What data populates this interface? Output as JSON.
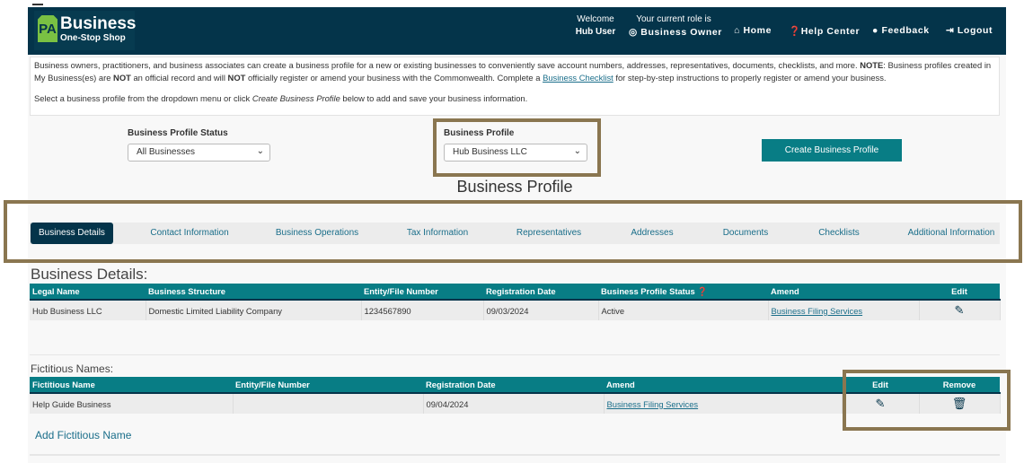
{
  "header": {
    "logo": {
      "mark": "PA",
      "title": "Business",
      "subtitle": "One-Stop Shop"
    },
    "welcome_label": "Welcome",
    "user_name": "Hub User",
    "role_label": "Your current role is",
    "role": "Business Owner",
    "role_icon": "user-circle-icon",
    "nav": [
      {
        "label": "Home",
        "icon": "home-icon"
      },
      {
        "label": "Help Center",
        "icon": "question-circle-icon"
      },
      {
        "label": "Feedback",
        "icon": "comment-icon"
      },
      {
        "label": "Logout",
        "icon": "sign-out-icon"
      }
    ]
  },
  "info": {
    "p1_a": "Business owners, practitioners, and business associates can create a business profile for a new or existing businesses to conveniently save account numbers, addresses, representatives, documents, checklists, and more. ",
    "p1_note": "NOTE",
    "p1_b": ": Business profiles created in My Business(es) are ",
    "not1": "NOT",
    "p1_c": " an official record and will ",
    "not2": "NOT",
    "p1_d": " officially register or amend your business with the Commonwealth. Complete a ",
    "link": "Business Checklist",
    "p1_e": " for step-by-step instructions to properly register or amend your business.",
    "p2_a": "Select a business profile from the dropdown menu or click ",
    "p2_em": "Create Business Profile",
    "p2_b": " below to add and save your business information."
  },
  "filters": {
    "status_label": "Business Profile Status",
    "status_value": "All Businesses",
    "profile_label": "Business Profile",
    "profile_value": "Hub Business LLC",
    "create_label": "Create Business Profile"
  },
  "page_title": "Business Profile",
  "tabs": [
    "Business Details",
    "Contact Information",
    "Business Operations",
    "Tax Information",
    "Representatives",
    "Addresses",
    "Documents",
    "Checklists",
    "Additional Information"
  ],
  "active_tab": "Business Details",
  "details": {
    "heading": "Business Details:",
    "columns": [
      "Legal Name",
      "Business Structure",
      "Entity/File Number",
      "Registration Date",
      "Business Profile Status",
      "Amend",
      "Edit"
    ],
    "row": {
      "legal_name": "Hub Business LLC",
      "structure": "Domestic Limited Liability Company",
      "entity": "1234567890",
      "reg_date": "09/03/2024",
      "status": "Active",
      "amend": "Business Filing Services"
    }
  },
  "fictitious": {
    "heading": "Fictitious Names:",
    "columns": [
      "Fictitious Name",
      "Entity/File Number",
      "Registration Date",
      "Amend",
      "Edit",
      "Remove"
    ],
    "row": {
      "name": "Help Guide Business",
      "entity": "",
      "reg_date": "09/04/2024",
      "amend": "Business Filing Services"
    },
    "add_label": "Add Fictitious Name"
  },
  "colors": {
    "header": "#04344a",
    "teal": "#087d85",
    "highlight_box": "#8a7650",
    "link": "#1a6e8a"
  }
}
